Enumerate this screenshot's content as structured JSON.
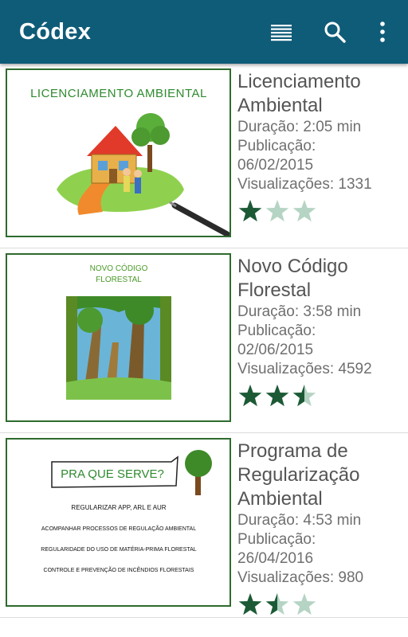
{
  "app": {
    "title": "Códex",
    "actions": [
      {
        "name": "list-view",
        "icon": "list-icon"
      },
      {
        "name": "search",
        "icon": "search-icon"
      },
      {
        "name": "more-options",
        "icon": "more-vertical-icon"
      }
    ]
  },
  "colors": {
    "appbar": "#0f5c78",
    "accent_green": "#2e6b2e",
    "star_filled": "#1c5a36",
    "star_empty": "#b5d4c4"
  },
  "videos": [
    {
      "title": "Licenciamento Ambiental",
      "duration": "Duração: 2:05 min",
      "publication_label": "Publicação:",
      "publication_date": "06/02/2015",
      "views": "Visualizações: 1331",
      "rating": 1,
      "thumbnail_text": "LICENCIAMENTO AMBIENTAL"
    },
    {
      "title": "Novo Código Florestal",
      "duration": "Duração: 3:58 min",
      "publication_label": "Publicação:",
      "publication_date": "02/06/2015",
      "views": "Visualizações: 4592",
      "rating": 2.5,
      "thumbnail_text": "NOVO CÓDIGO",
      "thumbnail_text2": "FLORESTAL"
    },
    {
      "title": "Programa de Regularização Ambiental",
      "duration": "Duração: 4:53 min",
      "publication_label": "Publicação:",
      "publication_date": "26/04/2016",
      "views": "Visualizações: 980",
      "rating": 1.5,
      "thumbnail_heading": "PRA QUE SERVE?",
      "thumbnail_lines": [
        "REGULARIZAR APP, ARL E AUR",
        "ACOMPANHAR PROCESSOS DE REGULAÇÃO AMBIENTAL",
        "REGULARIDADE DO USO DE MATÉRIA-PRIMA FLORESTAL",
        "CONTROLE E PREVENÇÃO DE INCÊNDIOS FLORESTAIS"
      ]
    }
  ]
}
